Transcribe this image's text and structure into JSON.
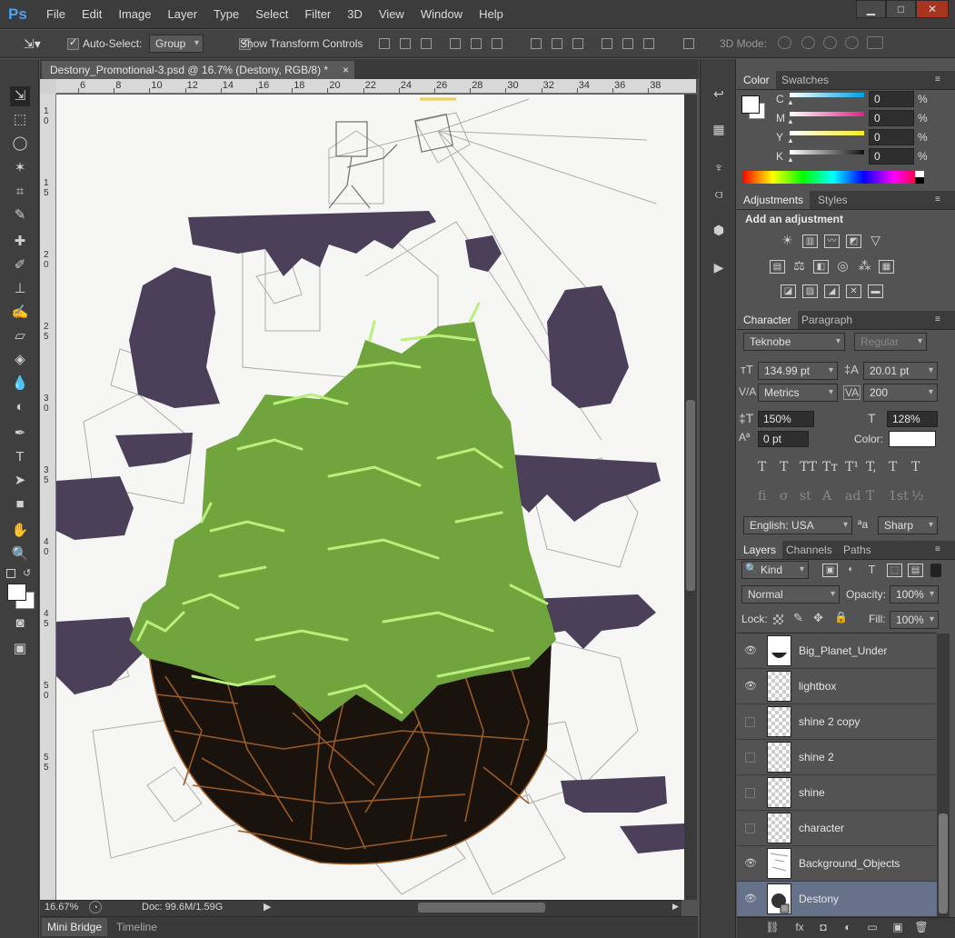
{
  "app": {
    "logo": "Ps",
    "menus": [
      "File",
      "Edit",
      "Image",
      "Layer",
      "Type",
      "Select",
      "Filter",
      "3D",
      "View",
      "Window",
      "Help"
    ],
    "window_buttons": {
      "minimize": "▁",
      "maximize": "□",
      "close": "✕"
    }
  },
  "options_bar": {
    "auto_select_label": "Auto-Select:",
    "auto_select_value": "Group",
    "show_transform_label": "Show Transform Controls",
    "mode_3d_label": "3D Mode:"
  },
  "document": {
    "tab_title": "Destony_Promotional-3.psd @ 16.7% (Destony, RGB/8) *",
    "close_glyph": "×",
    "ruler_h": [
      "6",
      "8",
      "10",
      "12",
      "14",
      "16",
      "18",
      "20",
      "22",
      "24",
      "26",
      "28",
      "30",
      "32",
      "34",
      "36",
      "38"
    ],
    "ruler_v": [
      "1\n0",
      "1\n5",
      "2\n0",
      "2\n5",
      "3\n0",
      "3\n5",
      "4\n0",
      "4\n5",
      "5\n0",
      "5\n5"
    ],
    "zoom": "16.67%",
    "doc_size": "Doc: 99.6M/1.59G"
  },
  "bottom_tabs": [
    "Mini Bridge",
    "Timeline"
  ],
  "color_panel": {
    "tabs": [
      "Color",
      "Swatches"
    ],
    "channels": [
      {
        "label": "C",
        "value": "0",
        "unit": "%",
        "gradient": "#00a0e0"
      },
      {
        "label": "M",
        "value": "0",
        "unit": "%",
        "gradient": "#e0208a"
      },
      {
        "label": "Y",
        "value": "0",
        "unit": "%",
        "gradient": "#f5ec20"
      },
      {
        "label": "K",
        "value": "0",
        "unit": "%",
        "gradient": "#111111"
      }
    ]
  },
  "adjustments_panel": {
    "tabs": [
      "Adjustments",
      "Styles"
    ],
    "heading": "Add an adjustment"
  },
  "character_panel": {
    "tabs": [
      "Character",
      "Paragraph"
    ],
    "font_family": "Teknobe",
    "font_style": "Regular",
    "font_size": "134.99 pt",
    "leading": "20.01 pt",
    "kerning": "Metrics",
    "tracking": "200",
    "vertical_scale": "150%",
    "horizontal_scale": "128%",
    "baseline_shift": "0 pt",
    "color_label": "Color:",
    "language": "English: USA",
    "antialias_glyph": "ªa",
    "antialias": "Sharp",
    "style_buttons": [
      "T",
      "T",
      "TT",
      "Tт",
      "T¹",
      "T,",
      "T",
      "T"
    ],
    "opentype_buttons": [
      "fi",
      "σ",
      "st",
      "A",
      "ad",
      "T",
      "1st",
      "½"
    ]
  },
  "layers_panel": {
    "tabs": [
      "Layers",
      "Channels",
      "Paths"
    ],
    "filter_kind": "Kind",
    "blend_mode": "Normal",
    "opacity_label": "Opacity:",
    "opacity": "100%",
    "lock_label": "Lock:",
    "fill_label": "Fill:",
    "fill": "100%",
    "layers": [
      {
        "name": "Big_Planet_Under",
        "visible": true
      },
      {
        "name": "lightbox",
        "visible": true
      },
      {
        "name": "shine 2 copy",
        "visible": false
      },
      {
        "name": "shine 2",
        "visible": false
      },
      {
        "name": "shine",
        "visible": false
      },
      {
        "name": "character",
        "visible": false
      },
      {
        "name": "Background_Objects",
        "visible": true
      },
      {
        "name": "Destony",
        "visible": true,
        "selected": true
      }
    ],
    "footer": [
      "⛓",
      "fx",
      "◘",
      "◐",
      "▭",
      "▣",
      "🗑"
    ]
  },
  "colors": {
    "grass": "#6fa53c",
    "grass_light": "#b9f07a",
    "soil": "#1a120c",
    "roots": "#9a5a25",
    "purple": "#4b3f5a",
    "selection": "#66718a"
  }
}
